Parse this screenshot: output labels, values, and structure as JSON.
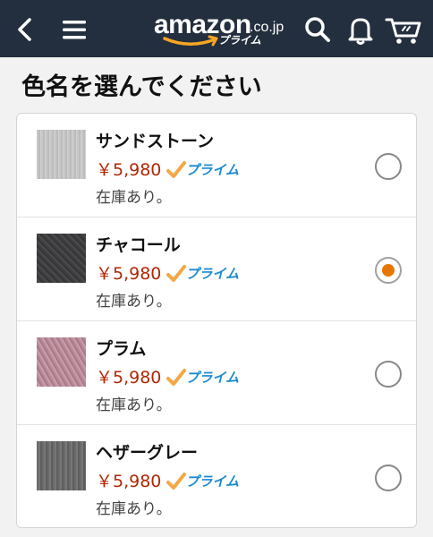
{
  "header": {
    "logo_text": "amazon",
    "logo_tld": ".co.jp",
    "logo_sub": "プライム",
    "icons": [
      "back-icon",
      "menu-icon",
      "search-icon",
      "bell-icon",
      "cart-icon"
    ],
    "colors": {
      "background": "#232f3e",
      "smile": "#f5a623"
    }
  },
  "page": {
    "title": "色名を選んでください"
  },
  "options": [
    {
      "name": "サンドストーン",
      "price": "￥5,980",
      "prime": "プライム",
      "stock": "在庫あり。",
      "selected": false,
      "swatch": "sand-stone"
    },
    {
      "name": "チャコール",
      "price": "￥5,980",
      "prime": "プライム",
      "stock": "在庫あり。",
      "selected": true,
      "swatch": "charcoal"
    },
    {
      "name": "プラム",
      "price": "￥5,980",
      "prime": "プライム",
      "stock": "在庫あり。",
      "selected": false,
      "swatch": "plum"
    },
    {
      "name": "ヘザーグレー",
      "price": "￥5,980",
      "prime": "プライム",
      "stock": "在庫あり。",
      "selected": false,
      "swatch": "heather-gray"
    }
  ],
  "colors": {
    "price": "#b12704",
    "prime": "#1a8ad2",
    "prime_check": "#f3a847",
    "radio_selected": "#e77600"
  }
}
